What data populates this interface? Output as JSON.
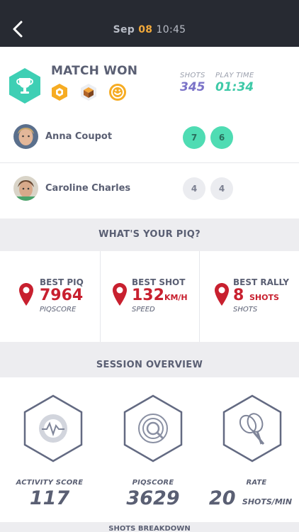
{
  "header": {
    "month": "Sep",
    "day": "08",
    "time": "10:45"
  },
  "match": {
    "result": "MATCH WON",
    "badges": [
      "hexagon-badge",
      "cube-badge",
      "smiley-badge"
    ],
    "shots_label": "SHOTS",
    "shots_value": "345",
    "playtime_label": "PLAY TIME",
    "playtime_value": "01:34"
  },
  "players": [
    {
      "name": "Anna Coupot",
      "scores": [
        "7",
        "6"
      ],
      "status": "win"
    },
    {
      "name": "Caroline Charles",
      "scores": [
        "4",
        "4"
      ],
      "status": "lose"
    }
  ],
  "piq_section": {
    "title": "WHAT'S YOUR PIQ?",
    "cards": [
      {
        "label": "BEST PIQ",
        "value": "7964",
        "unit": "",
        "sub": "PIQSCORE"
      },
      {
        "label": "BEST SHOT",
        "value": "132",
        "unit": "KM/H",
        "sub": "SPEED"
      },
      {
        "label": "BEST RALLY",
        "value": "8",
        "unit": "SHOTS",
        "sub": "SHOTS"
      }
    ]
  },
  "overview_section": {
    "title": "SESSION OVERVIEW",
    "items": [
      {
        "label": "ACTIVITY SCORE",
        "value": "117",
        "unit": "",
        "icon": "activity-icon"
      },
      {
        "label": "PIQSCORE",
        "value": "3629",
        "unit": "",
        "icon": "piq-logo-icon"
      },
      {
        "label": "RATE",
        "value": "20",
        "unit": "SHOTS/MIN",
        "icon": "racket-icon"
      }
    ]
  },
  "footer": {
    "title": "SHOTS BREAKDOWN"
  },
  "colors": {
    "header_bg": "#272a32",
    "accent_orange": "#f2a93b",
    "win_green": "#4fdcb3",
    "piq_red": "#c8202f",
    "shots_purple": "#7b73c8",
    "play_teal": "#3ec9a7"
  }
}
